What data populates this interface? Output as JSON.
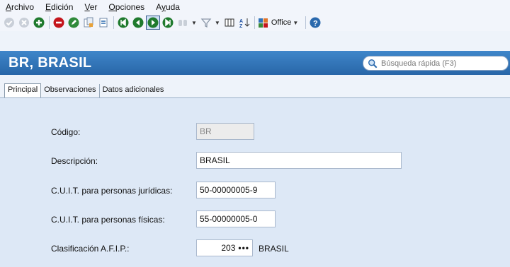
{
  "menu": [
    "Archivo",
    "Edición",
    "Ver",
    "Opciones",
    "Ayuda"
  ],
  "menu_mnemonic_rest": [
    "rchivo",
    "dición",
    "er",
    "pciones",
    "yuda"
  ],
  "toolbar": {
    "office_label": "Office"
  },
  "header": {
    "title": "BR, BRASIL",
    "search_placeholder": "Búsqueda rápida (F3)"
  },
  "tabs": [
    "Principal",
    "Observaciones",
    "Datos adicionales"
  ],
  "form": {
    "codigo_label": "Código:",
    "codigo_value": "BR",
    "descripcion_label": "Descripción:",
    "descripcion_value": "BRASIL",
    "cuit_juridicas_label": "C.U.I.T. para personas jurídicas:",
    "cuit_juridicas_value": "50-00000005-9",
    "cuit_fisicas_label": "C.U.I.T. para personas físicas:",
    "cuit_fisicas_value": "55-00000005-0",
    "afip_label": "Clasificación A.F.I.P.:",
    "afip_code": "203",
    "afip_dots": "•••",
    "afip_name": "BRASIL"
  },
  "colors": {
    "header_blue": "#2f72b8",
    "panel_bg": "#dde8f6"
  }
}
